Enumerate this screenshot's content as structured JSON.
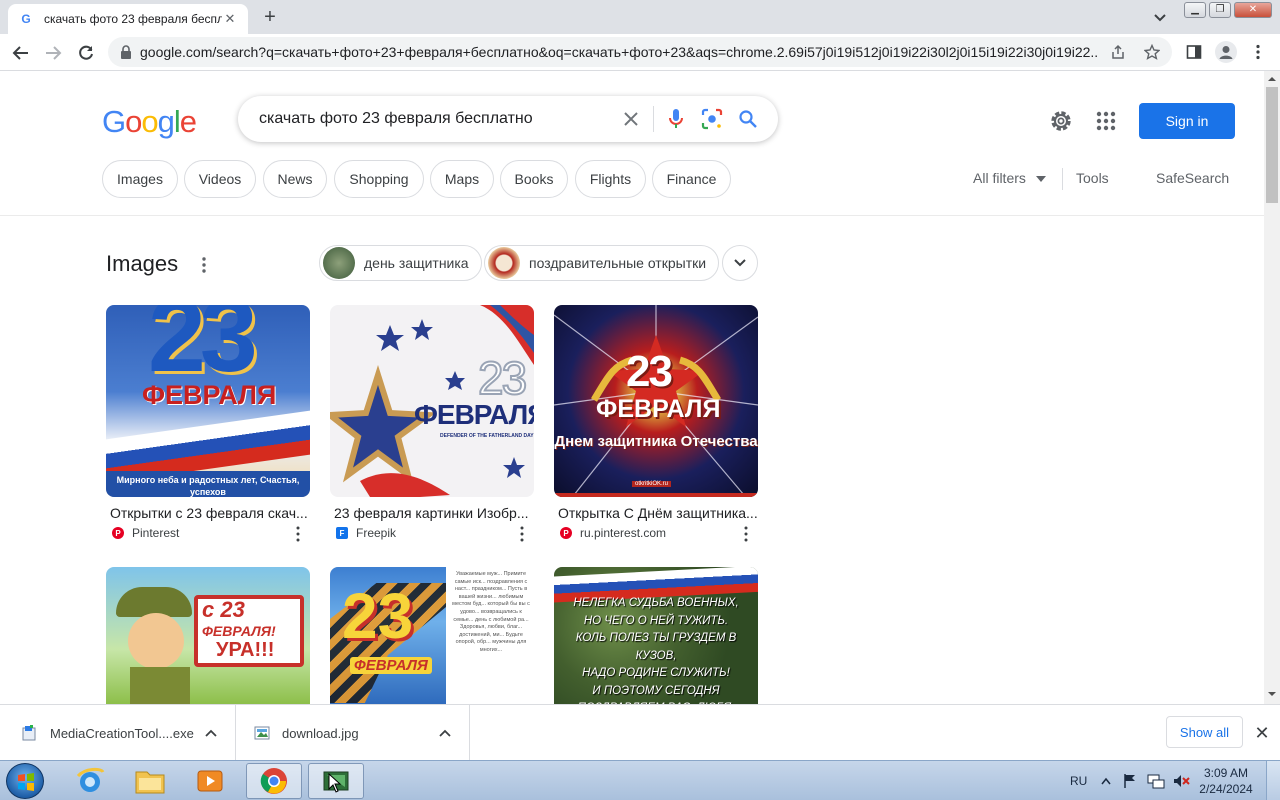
{
  "browser": {
    "tab_title": "скачать фото 23 февраля беспла",
    "tab_close": "✕",
    "new_tab": "+",
    "url": "google.com/search?q=скачать+фото+23+февраля+бесплатно&oq=скачать+фото+23&aqs=chrome.2.69i57j0i19i512j0i19i22i30l2j0i15i19i22i30j0i19i22..."
  },
  "google": {
    "logo_letters": [
      {
        "ch": "G",
        "color": "#4285f4"
      },
      {
        "ch": "o",
        "color": "#ea4335"
      },
      {
        "ch": "o",
        "color": "#fbbc05"
      },
      {
        "ch": "g",
        "color": "#4285f4"
      },
      {
        "ch": "l",
        "color": "#34a853"
      },
      {
        "ch": "e",
        "color": "#ea4335"
      }
    ],
    "query": "скачать фото 23 февраля бесплатно",
    "sign_in": "Sign in"
  },
  "filters": {
    "chips": [
      "Images",
      "Videos",
      "News",
      "Shopping",
      "Maps",
      "Books",
      "Flights",
      "Finance"
    ],
    "all_filters": "All filters",
    "tools": "Tools",
    "safesearch": "SafeSearch"
  },
  "images_section": {
    "title": "Images",
    "related": [
      "день защитника",
      "поздравительные открытки"
    ],
    "cards": [
      {
        "caption": "Открытки с 23 февраля скач...",
        "source": "Pinterest",
        "fav": "P",
        "fav_color": "#e60023",
        "big": "23",
        "word": "ФЕВРАЛЯ",
        "sub": "Мирного неба и радостных лет, Счастья, успехов"
      },
      {
        "caption": "23 февраля картинки Изобр...",
        "source": "Freepik",
        "fav": "F",
        "fav_color": "#1273eb",
        "big": "23",
        "word": "ФЕВРАЛЯ",
        "sub": "DEFENDER OF THE FATHERLAND DAY"
      },
      {
        "caption": "Открытка С Днём защитника...",
        "source": "ru.pinterest.com",
        "fav": "P",
        "fav_color": "#e60023",
        "big": "23",
        "word": "ФЕВРАЛЯ",
        "sub": "Днем защитника Отечества",
        "mark": "otkritkiOK.ru"
      },
      {
        "caption": "",
        "source": "",
        "big": "с 23",
        "word": "ФЕВРАЛЯ!",
        "sub": "УРА!!!"
      },
      {
        "caption": "",
        "source": "",
        "big": "23",
        "word": "ФЕВРАЛЯ",
        "sub": "Уважаемые муж... Примите самые иск... поздравления с наст... праздником... Пусть в вашей жизни... любимым местом буд... который бы вы с удово... возвращались к семье... день с любимой ра... Здоровья, любви, благ... достижений, ми... Будьте опорой, обр... мужчины для многих..."
      },
      {
        "caption": "",
        "source": "",
        "poem": [
          "НЕЛЕГКА СУДЬБА ВОЕННЫХ,",
          "НО ЧЕГО О НЕЙ ТУЖИТЬ.",
          "КОЛЬ ПОЛЕЗ ТЫ ГРУЗДЕМ В КУЗОВ,",
          "НАДО РОДИНЕ СЛУЖИТЬ!",
          "И ПОЭТОМУ СЕГОДНЯ",
          "ПОЗДРАВЛЯЕМ ВАС, ЛЮБЯ."
        ]
      }
    ]
  },
  "downloads": {
    "items": [
      "MediaCreationTool....exe",
      "download.jpg"
    ],
    "show_all": "Show all"
  },
  "taskbar": {
    "lang": "RU",
    "time": "3:09 AM",
    "date": "2/24/2024"
  }
}
